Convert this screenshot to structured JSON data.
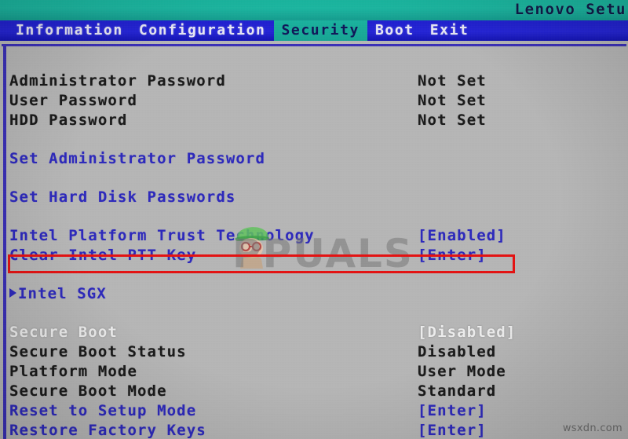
{
  "window": {
    "title": "Lenovo Setu",
    "title_full": "Lenovo Setup Utility"
  },
  "menu": {
    "items": [
      {
        "label": "Information",
        "selected": false
      },
      {
        "label": "Configuration",
        "selected": false
      },
      {
        "label": "Security",
        "selected": true
      },
      {
        "label": "Boot",
        "selected": false
      },
      {
        "label": "Exit",
        "selected": false
      }
    ]
  },
  "settings": {
    "rows": [
      {
        "type": "item",
        "label": "Administrator Password",
        "value": "Not Set",
        "label_color": "dark",
        "value_color": "dark",
        "submenu": false
      },
      {
        "type": "item",
        "label": "User Password",
        "value": "Not Set",
        "label_color": "dark",
        "value_color": "dark",
        "submenu": false
      },
      {
        "type": "item",
        "label": "HDD Password",
        "value": "Not Set",
        "label_color": "dark",
        "value_color": "dark",
        "submenu": false
      },
      {
        "type": "spacer",
        "label": "",
        "value": ""
      },
      {
        "type": "item",
        "label": "Set Administrator Password",
        "value": "",
        "label_color": "blue",
        "value_color": "blue",
        "submenu": false
      },
      {
        "type": "spacer",
        "label": "",
        "value": ""
      },
      {
        "type": "item",
        "label": "Set Hard Disk Passwords",
        "value": "",
        "label_color": "blue",
        "value_color": "blue",
        "submenu": false
      },
      {
        "type": "spacer",
        "label": "",
        "value": ""
      },
      {
        "type": "item",
        "label": "Intel Platform Trust Technology",
        "value": "[Enabled]",
        "label_color": "blue",
        "value_color": "blue",
        "submenu": false
      },
      {
        "type": "item",
        "label": "Clear Intel PTT Key",
        "value": "[Enter]",
        "label_color": "blue",
        "value_color": "blue",
        "submenu": false
      },
      {
        "type": "spacer",
        "label": "",
        "value": ""
      },
      {
        "type": "item",
        "label": "Intel SGX",
        "value": "",
        "label_color": "blue",
        "value_color": "blue",
        "submenu": true
      },
      {
        "type": "spacer",
        "label": "",
        "value": ""
      },
      {
        "type": "item",
        "label": "Secure Boot",
        "value": "[Disabled]",
        "label_color": "gray",
        "value_color": "gray",
        "submenu": false
      },
      {
        "type": "item",
        "label": "Secure Boot Status",
        "value": "Disabled",
        "label_color": "dark",
        "value_color": "dark",
        "submenu": false
      },
      {
        "type": "item",
        "label": "Platform Mode",
        "value": "User Mode",
        "label_color": "dark",
        "value_color": "dark",
        "submenu": false
      },
      {
        "type": "item",
        "label": "Secure Boot Mode",
        "value": "Standard",
        "label_color": "dark",
        "value_color": "dark",
        "submenu": false
      },
      {
        "type": "item",
        "label": "Reset to Setup Mode",
        "value": "[Enter]",
        "label_color": "blue",
        "value_color": "blue",
        "submenu": false
      },
      {
        "type": "item",
        "label": "Restore Factory Keys",
        "value": "[Enter]",
        "label_color": "blue",
        "value_color": "blue",
        "submenu": false
      }
    ]
  },
  "annotation": {
    "highlight_target": "Intel Platform Trust Technology",
    "color": "#ee1111"
  },
  "watermarks": {
    "brand": "PPUALS",
    "source": "wsxdn.com"
  },
  "colors": {
    "title_bar": "#13b8a0",
    "menu_bar": "#2424e0",
    "menu_selected": "#14b5a0",
    "panel_background": "#b7b7b7",
    "panel_rule": "#3b2fbf",
    "text_dark": "#1a1a1a",
    "text_blue": "#2d28c4",
    "text_gray": "#eeeeee",
    "annotation_red": "#ee1111"
  }
}
